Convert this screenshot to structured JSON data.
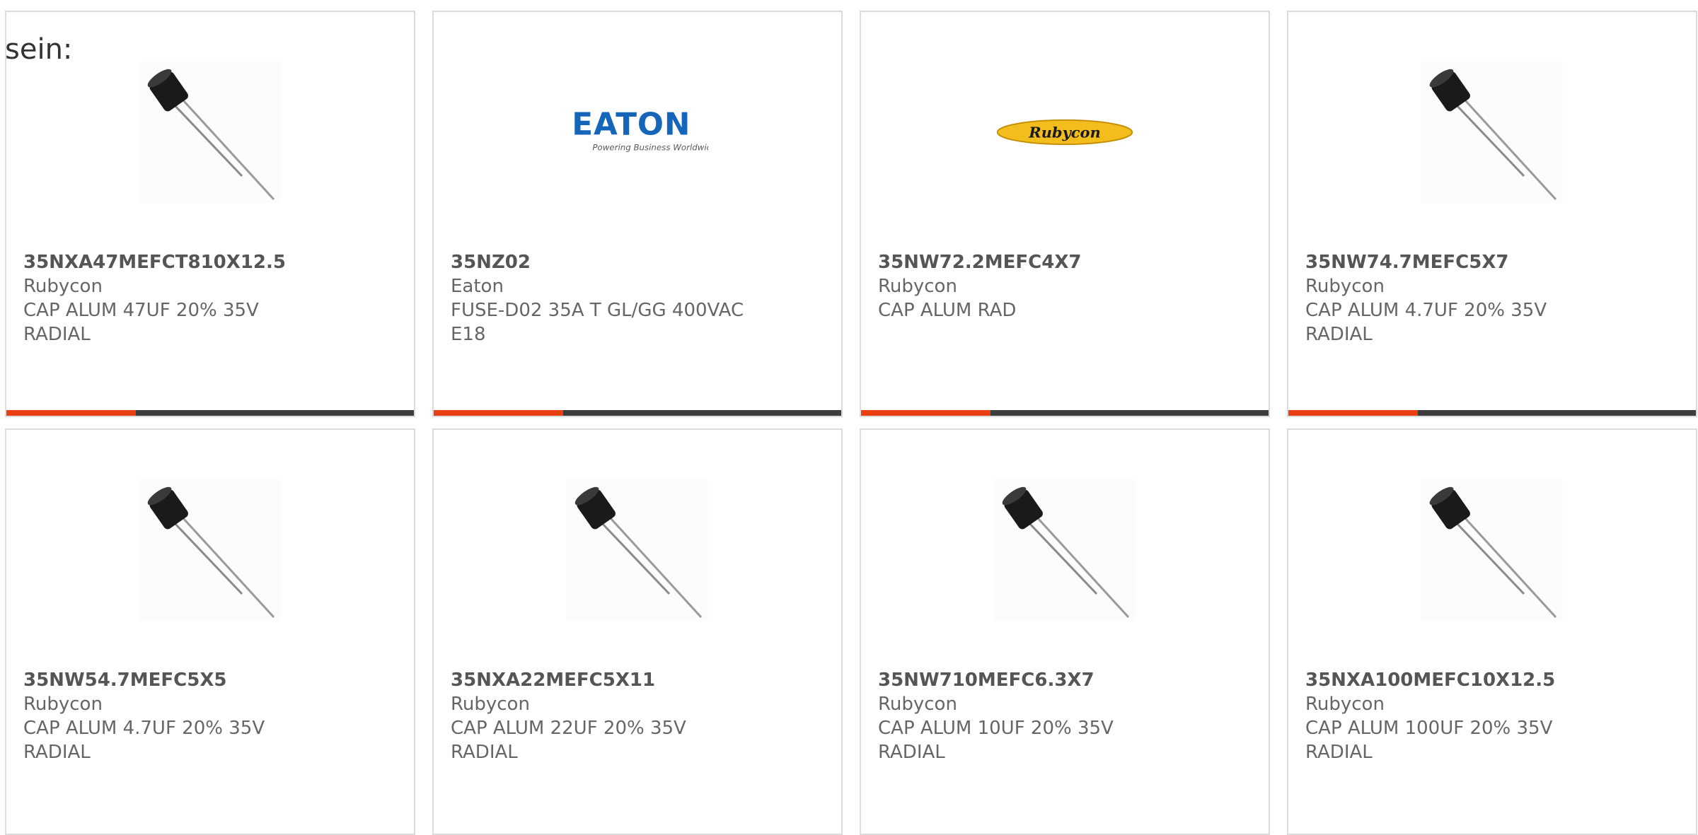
{
  "heading": "sein:",
  "colors": {
    "accent": "#e84012",
    "bar": "#3d3d3d",
    "border": "#dcdcdc",
    "text": "#666666"
  },
  "products": [
    {
      "part_number": "35NXA47MEFCT810X12.5",
      "manufacturer": "Rubycon",
      "description": "CAP ALUM 47UF 20% 35V RADIAL",
      "image": "capacitor-image"
    },
    {
      "part_number": "35NZ02",
      "manufacturer": "Eaton",
      "description": "FUSE-D02 35A T GL/GG 400VAC E18",
      "image": "eaton-logo",
      "logo_text": "EATON",
      "logo_tagline": "Powering Business Worldwide"
    },
    {
      "part_number": "35NW72.2MEFC4X7",
      "manufacturer": "Rubycon",
      "description": "CAP ALUM RAD",
      "image": "rubycon-logo",
      "logo_text": "Rubycon"
    },
    {
      "part_number": "35NW74.7MEFC5X7",
      "manufacturer": "Rubycon",
      "description": "CAP ALUM 4.7UF 20% 35V RADIAL",
      "image": "capacitor-image"
    },
    {
      "part_number": "35NW54.7MEFC5X5",
      "manufacturer": "Rubycon",
      "description": "CAP ALUM 4.7UF 20% 35V RADIAL",
      "image": "capacitor-image"
    },
    {
      "part_number": "35NXA22MEFC5X11",
      "manufacturer": "Rubycon",
      "description": "CAP ALUM 22UF 20% 35V RADIAL",
      "image": "capacitor-image"
    },
    {
      "part_number": "35NW710MEFC6.3X7",
      "manufacturer": "Rubycon",
      "description": "CAP ALUM 10UF 20% 35V RADIAL",
      "image": "capacitor-image"
    },
    {
      "part_number": "35NXA100MEFC10X12.5",
      "manufacturer": "Rubycon",
      "description": "CAP ALUM 100UF 20% 35V RADIAL",
      "image": "capacitor-image"
    }
  ]
}
